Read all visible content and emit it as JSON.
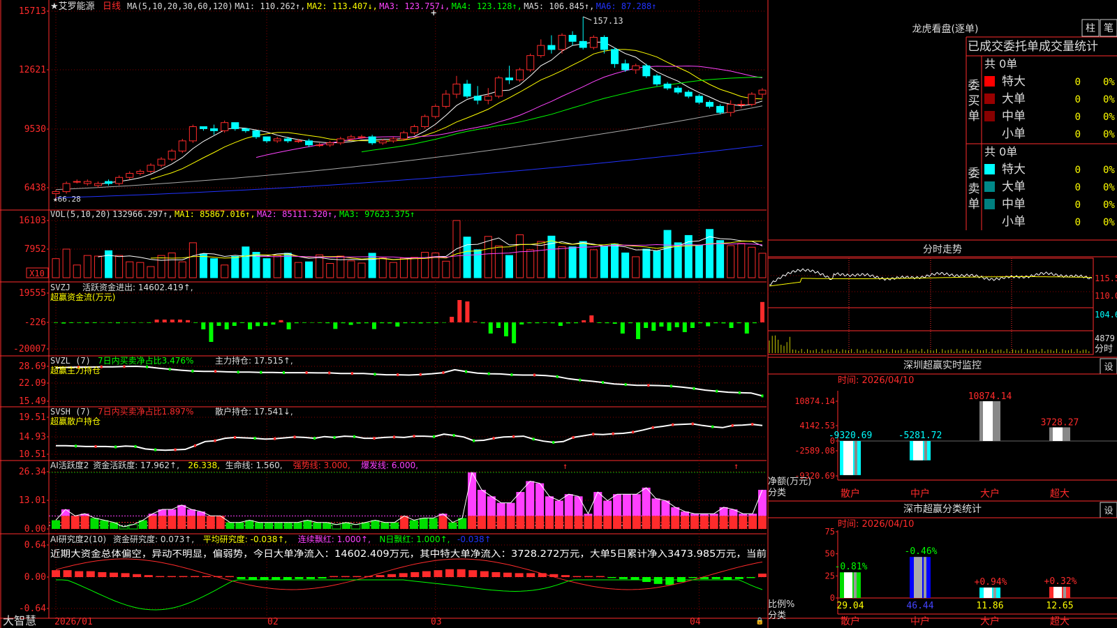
{
  "app": {
    "name": "大智慧",
    "stock": "艾罗能源",
    "period": "日线"
  },
  "colors": {
    "up": "#ff2b2b",
    "down": "#00ffff",
    "ma1": "#ffffff",
    "ma2": "#ffff00",
    "ma3": "#ff44ff",
    "ma4": "#00ff00",
    "ma5": "#aaaaaa",
    "ma6": "#2233ff",
    "grid": "#8b0000"
  },
  "panels": {
    "kline": {
      "header": [
        "★艾罗能源",
        "日线",
        "MA(5,10,20,30,60,120)",
        "MA1: 110.262↑,",
        "MA2: 113.407↓,",
        "MA3: 123.757↓,",
        "MA4: 123.128↑,",
        "MA5: 106.845↑,",
        "MA6: 87.288↑"
      ],
      "yticks": [
        "15713",
        "12621",
        "9530",
        "6438"
      ],
      "high_label": "157.13",
      "low_label": "66.28"
    },
    "vol": {
      "header": [
        "VOL(5,10,20)",
        "132966.297↑,",
        "MA1: 85867.016↑,",
        "MA2: 85111.320↑,",
        "MA3: 97623.375↑"
      ],
      "yticks": [
        "16103",
        "7952"
      ],
      "unit": "X10"
    },
    "svzj": {
      "header": [
        "SVZJ",
        "活跃资金进出: 14602.419↑,"
      ],
      "sub": "超赢资金流(万元)",
      "yticks": [
        "19555",
        "-226",
        "-20007"
      ]
    },
    "svzl": {
      "header": [
        "SVZL (7)",
        "7日内买卖净占比3.476%",
        "主力持仓: 17.515↑,"
      ],
      "sub": "超赢主力持仓",
      "yticks": [
        "28.69",
        "22.09",
        "15.49"
      ]
    },
    "svsh": {
      "header": [
        "SVSH (7)",
        "7日内买卖净占比1.897%",
        "散户持仓: 17.541↓,"
      ],
      "sub": "超赢散户持仓",
      "yticks": [
        "19.51",
        "14.93",
        "10.51"
      ]
    },
    "ai1": {
      "header": [
        "AI活跃度2",
        "资金活跃度: 17.962↑,",
        "26.338,",
        "生命线: 1.560,",
        "强势线: 3.000,",
        "爆发线: 6.000,"
      ],
      "yticks": [
        "26.34",
        "13.01",
        "0.00"
      ]
    },
    "ai2": {
      "header": [
        "AI研究度2(10)",
        "资金研究度: 0.073↑,",
        "平均研究度: -0.038↑,",
        "连续飘红: 1.000↑,",
        "N日飘红: 1.000↑,",
        "-0.038↑"
      ],
      "text": "近期大资金总体偏空，异动不明显，偏弱势，今日大单净流入：14602.409万元，其中特大单净流入：3728.272万元，大单5日累计净入3473.985万元，当前",
      "yticks": [
        "0.64",
        "0.00",
        "-0.64"
      ]
    }
  },
  "x_axis": {
    "labels": [
      "2026/01",
      "02",
      "03",
      "04"
    ]
  },
  "right": {
    "lhb": {
      "title": "龙虎看盘(逐单)",
      "btn1": "柱",
      "btn2": "笔",
      "subtitle": "已成交委托单成交量统计",
      "buy": {
        "label": "委买单",
        "total": "共 0单",
        "rows": [
          {
            "name": "特大",
            "v": "0",
            "p": "0%"
          },
          {
            "name": "大单",
            "v": "0",
            "p": "0%"
          },
          {
            "name": "中单",
            "v": "0",
            "p": "0%"
          },
          {
            "name": "小单",
            "v": "0",
            "p": "0%"
          }
        ]
      },
      "sell": {
        "label": "委卖单",
        "total": "共 0单",
        "rows": [
          {
            "name": "特大",
            "v": "0",
            "p": "0%"
          },
          {
            "name": "大单",
            "v": "0",
            "p": "0%"
          },
          {
            "name": "中单",
            "v": "0",
            "p": "0%"
          },
          {
            "name": "小单",
            "v": "0",
            "p": "0%"
          }
        ]
      }
    },
    "fenshi": {
      "title": "分时走势",
      "yticks": [
        "115.5",
        "110.0",
        "104.6"
      ],
      "vol_tick": "4879",
      "vol_label": "分时"
    },
    "szmon": {
      "title": "深圳超赢实时监控",
      "btn": "设",
      "time": "时间: 2026/04/10",
      "yticks": [
        "10874.14",
        "4142.53",
        "0",
        "-2589.08",
        "-9320.69"
      ],
      "ylabel": "净额(万元)",
      "xlabel": "分类",
      "cats": [
        "散户",
        "中户",
        "大户",
        "超大"
      ],
      "values": [
        -9320.69,
        -5281.72,
        10874.14,
        3728.27
      ],
      "labels": [
        "-9320.69",
        "-5281.72",
        "10874.14",
        "3728.27"
      ]
    },
    "szcls": {
      "title": "深市超赢分类统计",
      "btn": "设",
      "time": "时间: 2026/04/10",
      "yticks": [
        "75",
        "50",
        "25",
        "0"
      ],
      "ylabel": "比例%",
      "xlabel": "分类",
      "cats": [
        "散户",
        "中户",
        "大户",
        "超大"
      ],
      "values": [
        29.04,
        46.44,
        11.86,
        12.65
      ],
      "labels": [
        "29.04",
        "46.44",
        "11.86",
        "12.65"
      ],
      "deltas": [
        "-0.81%",
        "-0.46%",
        "+0.94%",
        "+0.32%"
      ]
    }
  },
  "chart_data": [
    {
      "type": "candlestick",
      "title": "艾罗能源 日线",
      "x_axis": [
        "2026/01",
        "02",
        "03",
        "04"
      ],
      "ylim": [
        64.0,
        158.5
      ],
      "open": [
        70,
        71,
        76,
        75,
        74,
        76,
        75,
        78,
        80,
        81,
        84,
        87,
        91,
        96,
        103,
        102,
        101,
        105,
        102,
        101,
        98,
        96,
        97,
        96,
        96,
        94,
        94,
        95,
        97,
        98,
        98,
        95,
        96,
        97,
        100,
        103,
        108,
        113,
        119,
        124,
        118,
        116,
        118,
        127,
        126,
        131,
        138,
        143,
        141,
        148,
        145,
        142,
        147,
        141,
        134,
        131,
        133,
        128,
        124,
        122,
        120,
        118,
        115,
        113,
        110,
        114,
        114,
        119
      ],
      "close": [
        71,
        75,
        76,
        76,
        75,
        75,
        78,
        80,
        81,
        84,
        87,
        91,
        96,
        103,
        102,
        101,
        105,
        102,
        101,
        98,
        96,
        97,
        96,
        96,
        94,
        94,
        95,
        97,
        98,
        98,
        95,
        96,
        97,
        100,
        103,
        108,
        113,
        119,
        124,
        118,
        116,
        118,
        127,
        126,
        131,
        138,
        143,
        141,
        148,
        145,
        142,
        147,
        141,
        134,
        131,
        133,
        128,
        124,
        122,
        120,
        118,
        115,
        113,
        110,
        114,
        114,
        119,
        121
      ],
      "high": [
        72,
        76,
        77,
        77,
        76,
        77,
        79,
        81,
        82,
        85,
        88,
        92,
        97,
        104,
        103,
        104,
        106,
        104,
        102,
        101,
        98,
        98,
        98,
        97,
        97,
        95,
        96,
        98,
        99,
        99,
        99,
        97,
        98,
        101,
        104,
        109,
        114,
        121,
        128,
        126,
        123,
        122,
        128,
        133,
        132,
        139,
        146,
        148,
        149,
        150,
        157.13,
        148,
        148,
        142,
        136,
        134,
        134,
        129,
        125,
        123,
        121,
        119,
        116,
        114,
        116,
        116,
        120,
        122
      ],
      "low": [
        66.28,
        70,
        75,
        74,
        73,
        74,
        74,
        77,
        79,
        80,
        83,
        86,
        90,
        95,
        101,
        99,
        100,
        101,
        100,
        97,
        95,
        95,
        95,
        95,
        93,
        93,
        93,
        94,
        96,
        97,
        94,
        94,
        95,
        96,
        99,
        102,
        107,
        112,
        117,
        117,
        114,
        114,
        117,
        124,
        125,
        130,
        137,
        139,
        139,
        143,
        141,
        141,
        139,
        132,
        130,
        129,
        127,
        123,
        121,
        119,
        117,
        114,
        112,
        109,
        108,
        112,
        113,
        117
      ],
      "ma": {
        "MA1": 110.262,
        "MA2": 113.407,
        "MA3": 123.757,
        "MA4": 123.128,
        "MA5": 106.845,
        "MA6": 87.288
      }
    },
    {
      "type": "bar",
      "title": "VOL(5,10,20)",
      "values": [
        6000,
        9000,
        4000,
        7000,
        6800,
        8500,
        7000,
        5000,
        4800,
        3500,
        7000,
        7800,
        5000,
        11000,
        7500,
        6000,
        4000,
        6700,
        9700,
        8000,
        6000,
        7000,
        7700,
        4800,
        5000,
        7200,
        4500,
        6800,
        5300,
        4600,
        7700,
        6200,
        4800,
        6200,
        6400,
        8000,
        7800,
        5200,
        18000,
        12800,
        8800,
        13000,
        10000,
        7000,
        13500,
        8800,
        11400,
        13100,
        9800,
        9700,
        11400,
        8800,
        10000,
        10600,
        7800,
        6600,
        9000,
        8400,
        14900,
        11000,
        13300,
        10300,
        15200,
        11700,
        10100,
        10800,
        9600,
        7700
      ],
      "unit": "X10"
    },
    {
      "type": "bar",
      "title": "超赢资金流(万元)",
      "values": [
        -400,
        -800,
        -500,
        -400,
        -600,
        -500,
        -300,
        -400,
        -600,
        -300,
        -400,
        -300,
        -400,
        2000,
        2000,
        2000,
        2000,
        1600,
        -400,
        -5000,
        -14000,
        -2500,
        -5000,
        -2500,
        -500,
        -5000,
        -2700,
        -2500,
        -1600,
        1600,
        -5000,
        -600,
        -400,
        -300,
        -400,
        -600,
        -4700,
        -600,
        -1800,
        -800,
        -600,
        -4800,
        -600,
        -700,
        -3000,
        -600,
        -500,
        -700,
        -400,
        -600,
        -300,
        4000,
        16000,
        15000,
        600,
        -600,
        -8000,
        -4000,
        -10000,
        -15000,
        -1500,
        -600,
        -600,
        -500,
        -600,
        -2500,
        -700,
        -600,
        1500,
        5000,
        -500,
        -600,
        -1000,
        -8000,
        -600,
        -12000,
        -4000,
        -6000,
        -3000,
        -6000,
        -3500,
        -7000,
        -4000,
        -600,
        -2800,
        -600,
        -700,
        -4000,
        -600,
        -8000,
        -600,
        14602
      ]
    },
    {
      "type": "line",
      "title": "超赢主力持仓",
      "ylim": [
        15.49,
        28.69
      ],
      "values": [
        28.1,
        28.3,
        28.4,
        28.4,
        28.5,
        28.5,
        28.6,
        28.7,
        28.5,
        28.0,
        27.6,
        27.2,
        26.9,
        26.8,
        26.8,
        26.6,
        26.5,
        26.5,
        26.4,
        26.4,
        26.3,
        26.3,
        26.3,
        26.2,
        26.2,
        26.0,
        26.0,
        26.0,
        25.7,
        25.5,
        25.5,
        25.4,
        25.6,
        25.9,
        26.3,
        27.4,
        26.7,
        26.1,
        25.9,
        25.8,
        25.5,
        25.4,
        25.4,
        25.2,
        24.8,
        24.0,
        23.5,
        23.1,
        22.6,
        22.0,
        21.8,
        21.5,
        21.5,
        21.4,
        21.2,
        20.8,
        20.3,
        19.7,
        19.3,
        18.9,
        18.7,
        18.6,
        17.5
      ]
    },
    {
      "type": "line",
      "title": "超赢散户持仓",
      "ylim": [
        10.51,
        19.51
      ],
      "values": [
        12.6,
        12.6,
        12.5,
        12.4,
        12.4,
        12.4,
        12.3,
        12.5,
        12.4,
        11.8,
        11.6,
        11.5,
        11.6,
        11.7,
        12.6,
        13.6,
        13.8,
        14.4,
        14.6,
        14.5,
        14.4,
        14.2,
        14.3,
        14.5,
        14.7,
        14.6,
        14.4,
        14.8,
        14.6,
        14.9,
        14.8,
        14.4,
        14.4,
        14.6,
        14.7,
        14.6,
        14.9,
        14.9,
        14.8,
        15.4,
        15.1,
        14.7,
        13.8,
        13.9,
        14.4,
        14.7,
        14.8,
        14.9,
        14.2,
        13.7,
        13.4,
        13.6,
        14.6,
        15.0,
        15.4,
        15.3,
        15.5,
        15.6,
        15.9,
        16.4,
        17.0,
        17.3,
        17.7,
        17.8,
        17.9,
        17.5,
        17.2,
        17.0,
        17.5,
        17.6,
        17.8,
        17.5
      ]
    },
    {
      "type": "bar",
      "title": "AI活跃度2",
      "ylim": [
        0,
        26.34
      ],
      "values": [
        4,
        9,
        6,
        7,
        5,
        4,
        3,
        1,
        2,
        4,
        7,
        9,
        9,
        11,
        9,
        8,
        6,
        6,
        3,
        3,
        4,
        3,
        3,
        3,
        3,
        3,
        4,
        3,
        3,
        2,
        3,
        2,
        3,
        4,
        3,
        3,
        6,
        4,
        5,
        5,
        7,
        3,
        5,
        26,
        18,
        15,
        12,
        12,
        17,
        22,
        21,
        15,
        13,
        16,
        15,
        7,
        17,
        13,
        16,
        16,
        16,
        19,
        14,
        13,
        10,
        8,
        7,
        7,
        7,
        10,
        9,
        7,
        7,
        18
      ],
      "lines": {
        "生命线": 1.56,
        "强势线": 3.0,
        "爆发线": 6.0
      }
    },
    {
      "type": "bar",
      "title": "AI研究度2(10)",
      "ylim": [
        -0.64,
        0.64
      ],
      "values": [
        0.14,
        0.14,
        0.12,
        0.12,
        0.1,
        0.09,
        0.08,
        0.06,
        0.04,
        0.02,
        0.02,
        0.02,
        0.02,
        0.02,
        0.02,
        0.02,
        -0.04,
        -0.06,
        -0.06,
        -0.06,
        -0.05,
        -0.04,
        -0.04,
        -0.03,
        0.02,
        0.02,
        0.02,
        0.02,
        0.04,
        0.06,
        0.08,
        0.1,
        0.12,
        0.14,
        0.16,
        0.16,
        0.14,
        0.12,
        0.1,
        0.09,
        0.08,
        0.08,
        0.08,
        0.06,
        0.04,
        0.02,
        0.02,
        0.02,
        -0.02,
        -0.04,
        -0.06,
        -0.1,
        -0.14,
        -0.16,
        -0.1,
        -0.02,
        -0.04,
        -0.04,
        -0.06,
        -0.04,
        -0.02,
        0.07
      ]
    },
    {
      "type": "bar",
      "title": "深圳超赢实时监控",
      "categories": [
        "散户",
        "中户",
        "大户",
        "超大"
      ],
      "values": [
        -9320.69,
        -5281.72,
        10874.14,
        3728.27
      ],
      "ylim": [
        -9320.69,
        10874.14
      ],
      "ylabel": "净额(万元)"
    },
    {
      "type": "bar",
      "title": "深市超赢分类统计",
      "categories": [
        "散户",
        "中户",
        "大户",
        "超大"
      ],
      "values": [
        29.04,
        46.44,
        11.86,
        12.65
      ],
      "changes": [
        "-0.81%",
        "-0.46%",
        "+0.94%",
        "+0.32%"
      ],
      "ylim": [
        0,
        75
      ],
      "ylabel": "比例%"
    }
  ]
}
